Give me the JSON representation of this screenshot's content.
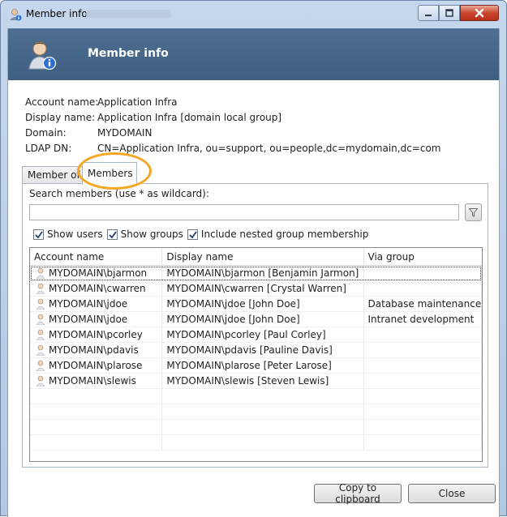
{
  "window": {
    "title": "Member info"
  },
  "header": {
    "title": "Member info"
  },
  "info": {
    "rows": [
      {
        "label": "Account name:",
        "value": "Application Infra"
      },
      {
        "label": "Display name:",
        "value": "Application Infra [domain local group]"
      },
      {
        "label": "Domain:",
        "value": "MYDOMAIN"
      },
      {
        "label": "LDAP DN:",
        "value": "CN=Application Infra, ou=support, ou=people,dc=mydomain,dc=com"
      }
    ]
  },
  "tabs": {
    "member_of": "Member of",
    "members": "Members"
  },
  "search": {
    "label": "Search members (use * as wildcard):",
    "value": ""
  },
  "checks": [
    {
      "label": "Show users",
      "checked": true
    },
    {
      "label": "Show groups",
      "checked": true
    },
    {
      "label": "Include nested group membership",
      "checked": true
    }
  ],
  "table": {
    "columns": [
      "Account name",
      "Display name",
      "Via group"
    ],
    "rows": [
      [
        "MYDOMAIN\\bjarmon",
        "MYDOMAIN\\bjarmon [Benjamin Jarmon]",
        ""
      ],
      [
        "MYDOMAIN\\cwarren",
        "MYDOMAIN\\cwarren [Crystal Warren]",
        ""
      ],
      [
        "MYDOMAIN\\jdoe",
        "MYDOMAIN\\jdoe [John Doe]",
        "Database maintenance"
      ],
      [
        "MYDOMAIN\\jdoe",
        "MYDOMAIN\\jdoe [John Doe]",
        "Intranet development"
      ],
      [
        "MYDOMAIN\\pcorley",
        "MYDOMAIN\\pcorley [Paul Corley]",
        ""
      ],
      [
        "MYDOMAIN\\pdavis",
        "MYDOMAIN\\pdavis  [Pauline Davis]",
        ""
      ],
      [
        "MYDOMAIN\\plarose",
        "MYDOMAIN\\plarose [Peter Larose]",
        ""
      ],
      [
        "MYDOMAIN\\slewis",
        "MYDOMAIN\\slewis [Steven Lewis]",
        ""
      ]
    ]
  },
  "buttons": {
    "copy": "Copy to clipboard",
    "close": "Close"
  },
  "colors": {
    "header": "#4e6f92",
    "highlight": "#f5a623",
    "close_button": "#c8462e"
  }
}
